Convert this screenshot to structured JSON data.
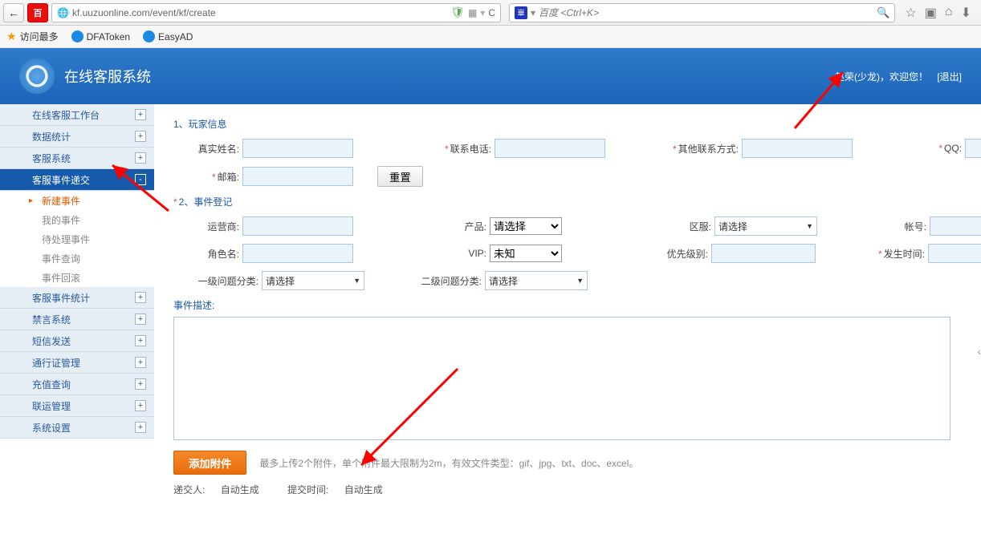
{
  "browser": {
    "url": "kf.uuzuonline.com/event/kf/create",
    "search_placeholder": "百度 <Ctrl+K>",
    "bookmarks": {
      "most": "访问最多",
      "b1": "DFAToken",
      "b2": "EasyAD"
    }
  },
  "header": {
    "app_title": "在线客服系统",
    "welcome": "赵荣(少龙)，欢迎您！",
    "logout": "[退出]"
  },
  "sidebar": {
    "items": [
      {
        "label": "在线客服工作台",
        "toggle": "+"
      },
      {
        "label": "数据统计",
        "toggle": "+"
      },
      {
        "label": "客服系统",
        "toggle": "+"
      },
      {
        "label": "客服事件递交",
        "toggle": "-",
        "active": true
      },
      {
        "label": "客服事件统计",
        "toggle": "+"
      },
      {
        "label": "禁言系统",
        "toggle": "+"
      },
      {
        "label": "短信发送",
        "toggle": "+"
      },
      {
        "label": "通行证管理",
        "toggle": "+"
      },
      {
        "label": "充值查询",
        "toggle": "+"
      },
      {
        "label": "联运管理",
        "toggle": "+"
      },
      {
        "label": "系统设置",
        "toggle": "+"
      }
    ],
    "subs": [
      {
        "label": "新建事件",
        "current": true
      },
      {
        "label": "我的事件"
      },
      {
        "label": "待处理事件"
      },
      {
        "label": "事件查询"
      },
      {
        "label": "事件回滚"
      }
    ]
  },
  "form": {
    "section1": "1、玩家信息",
    "section2": "2、事件登记",
    "labels": {
      "realname": "真实姓名:",
      "phone": "联系电话:",
      "other": "其他联系方式:",
      "qq": "QQ:",
      "email": "邮箱:",
      "reset": "重置",
      "operator": "运营商:",
      "product": "产品:",
      "zone": "区服:",
      "account": "帐号:",
      "role": "角色名:",
      "vip": "VIP:",
      "priority": "优先级别:",
      "happen": "发生时间:",
      "cat1": "一级问题分类:",
      "cat2": "二级问题分类:",
      "desc": "事件描述:"
    },
    "combo": {
      "select": "请选择",
      "unknown": "未知"
    },
    "attach_btn": "添加附件",
    "attach_hint": "最多上传2个附件，单个附件最大限制为2m，有效文件类型：gif、jpg、txt、doc、excel。",
    "submitter_lbl": "递交人:",
    "submitter_val": "自动生成",
    "submittime_lbl": "提交时间:",
    "submittime_val": "自动生成"
  }
}
